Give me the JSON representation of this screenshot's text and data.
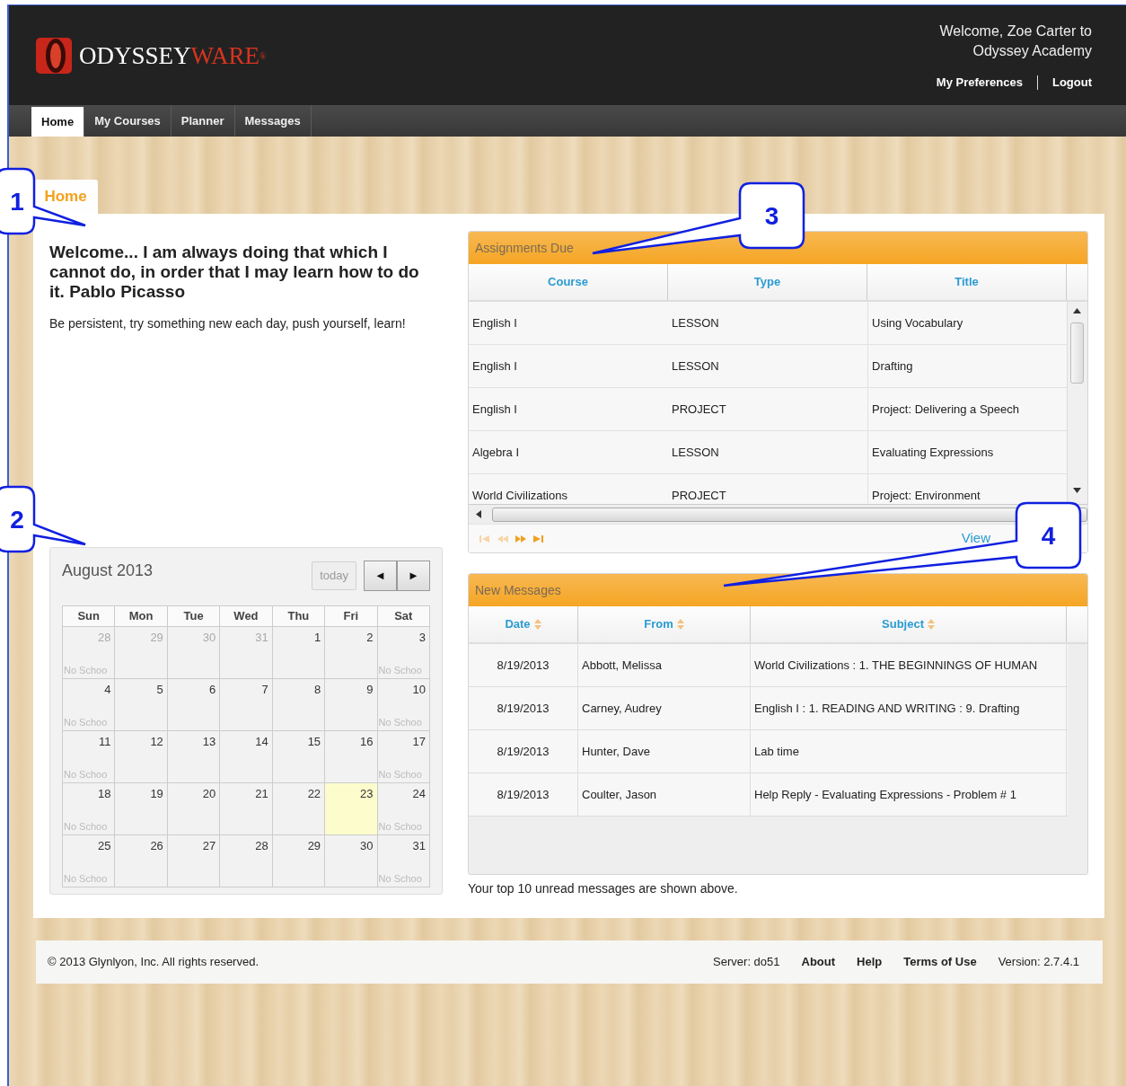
{
  "header": {
    "logo": {
      "primary": "ODYSSEY",
      "accent": "WARE",
      "mark": "®"
    },
    "welcome": "Welcome, Zoe Carter to Odyssey Academy",
    "links": [
      "My Preferences",
      "Logout"
    ]
  },
  "nav": [
    {
      "label": "Home",
      "selected": true
    },
    {
      "label": "My Courses",
      "selected": false
    },
    {
      "label": "Planner",
      "selected": false
    },
    {
      "label": "Messages",
      "selected": false
    }
  ],
  "page_tab": "Home",
  "quote": "Welcome... I am always doing that which I cannot do, in order that I may learn how to do it. Pablo Picasso",
  "motto": "Be persistent, try something new each day, push yourself, learn!",
  "calendar": {
    "title": "August 2013",
    "today_button": "today",
    "prev": "◄",
    "next": "►",
    "weekdays": [
      "Sun",
      "Mon",
      "Tue",
      "Wed",
      "Thu",
      "Fri",
      "Sat"
    ],
    "weeks": [
      [
        {
          "day": "28",
          "muted": true,
          "today": false,
          "note": "No Schoo"
        },
        {
          "day": "29",
          "muted": true,
          "today": false
        },
        {
          "day": "30",
          "muted": true,
          "today": false
        },
        {
          "day": "31",
          "muted": true,
          "today": false
        },
        {
          "day": "1",
          "muted": false,
          "today": false
        },
        {
          "day": "2",
          "muted": false,
          "today": false
        },
        {
          "day": "3",
          "muted": false,
          "today": false,
          "note": "No Schoo"
        }
      ],
      [
        {
          "day": "4",
          "muted": false,
          "today": false,
          "note": "No Schoo"
        },
        {
          "day": "5",
          "muted": false,
          "today": false
        },
        {
          "day": "6",
          "muted": false,
          "today": false
        },
        {
          "day": "7",
          "muted": false,
          "today": false
        },
        {
          "day": "8",
          "muted": false,
          "today": false
        },
        {
          "day": "9",
          "muted": false,
          "today": false
        },
        {
          "day": "10",
          "muted": false,
          "today": false,
          "note": "No Schoo"
        }
      ],
      [
        {
          "day": "11",
          "muted": false,
          "today": false,
          "note": "No Schoo"
        },
        {
          "day": "12",
          "muted": false,
          "today": false
        },
        {
          "day": "13",
          "muted": false,
          "today": false
        },
        {
          "day": "14",
          "muted": false,
          "today": false
        },
        {
          "day": "15",
          "muted": false,
          "today": false
        },
        {
          "day": "16",
          "muted": false,
          "today": false
        },
        {
          "day": "17",
          "muted": false,
          "today": false,
          "note": "No Schoo"
        }
      ],
      [
        {
          "day": "18",
          "muted": false,
          "today": false,
          "note": "No Schoo"
        },
        {
          "day": "19",
          "muted": false,
          "today": false
        },
        {
          "day": "20",
          "muted": false,
          "today": false
        },
        {
          "day": "21",
          "muted": false,
          "today": false
        },
        {
          "day": "22",
          "muted": false,
          "today": false
        },
        {
          "day": "23",
          "muted": false,
          "today": true
        },
        {
          "day": "24",
          "muted": false,
          "today": false,
          "note": "No Schoo"
        }
      ],
      [
        {
          "day": "25",
          "muted": false,
          "today": false,
          "note": "No Schoo"
        },
        {
          "day": "26",
          "muted": false,
          "today": false
        },
        {
          "day": "27",
          "muted": false,
          "today": false
        },
        {
          "day": "28",
          "muted": false,
          "today": false
        },
        {
          "day": "29",
          "muted": false,
          "today": false
        },
        {
          "day": "30",
          "muted": false,
          "today": false
        },
        {
          "day": "31",
          "muted": false,
          "today": false,
          "note": "No Schoo"
        }
      ]
    ]
  },
  "assignments": {
    "title": "Assignments Due",
    "columns": [
      {
        "label": "Course",
        "sortable": false
      },
      {
        "label": "Type",
        "sortable": false
      },
      {
        "label": "Title",
        "sortable": false
      }
    ],
    "rows": [
      [
        "English I",
        "LESSON",
        "Using Vocabulary"
      ],
      [
        "English I",
        "LESSON",
        "Drafting"
      ],
      [
        "English I",
        "PROJECT",
        "Project: Delivering a Speech"
      ],
      [
        "Algebra I",
        "LESSON",
        "Evaluating Expressions"
      ],
      [
        "World Civilizations",
        "PROJECT",
        "Project: Environment"
      ]
    ],
    "pager": [
      {
        "kind": "first",
        "disabled": true
      },
      {
        "kind": "prev",
        "disabled": true
      },
      {
        "kind": "next",
        "disabled": false
      },
      {
        "kind": "last",
        "disabled": false
      }
    ],
    "view_link": "View"
  },
  "messages": {
    "title": "New Messages",
    "columns": [
      {
        "label": "Date",
        "sortable": true
      },
      {
        "label": "From",
        "sortable": true
      },
      {
        "label": "Subject",
        "sortable": true
      }
    ],
    "rows": [
      [
        "8/19/2013",
        "Abbott, Melissa",
        "World Civilizations : 1. THE BEGINNINGS OF HUMAN"
      ],
      [
        "8/19/2013",
        "Carney, Audrey",
        "English I : 1. READING AND WRITING : 9. Drafting"
      ],
      [
        "8/19/2013",
        "Hunter, Dave",
        "Lab time"
      ],
      [
        "8/19/2013",
        "Coulter, Jason",
        "Help Reply - Evaluating Expressions - Problem # 1"
      ]
    ],
    "note": "Your top 10 unread messages are shown above."
  },
  "footer": {
    "copyright": "© 2013 Glynlyon, Inc. All rights reserved.",
    "server": "Server: do51",
    "links": [
      "About",
      "Help",
      "Terms of Use"
    ],
    "version": "Version: 2.7.4.1"
  },
  "callouts": [
    {
      "label": "1"
    },
    {
      "label": "2"
    },
    {
      "label": "3"
    },
    {
      "label": "4"
    }
  ]
}
